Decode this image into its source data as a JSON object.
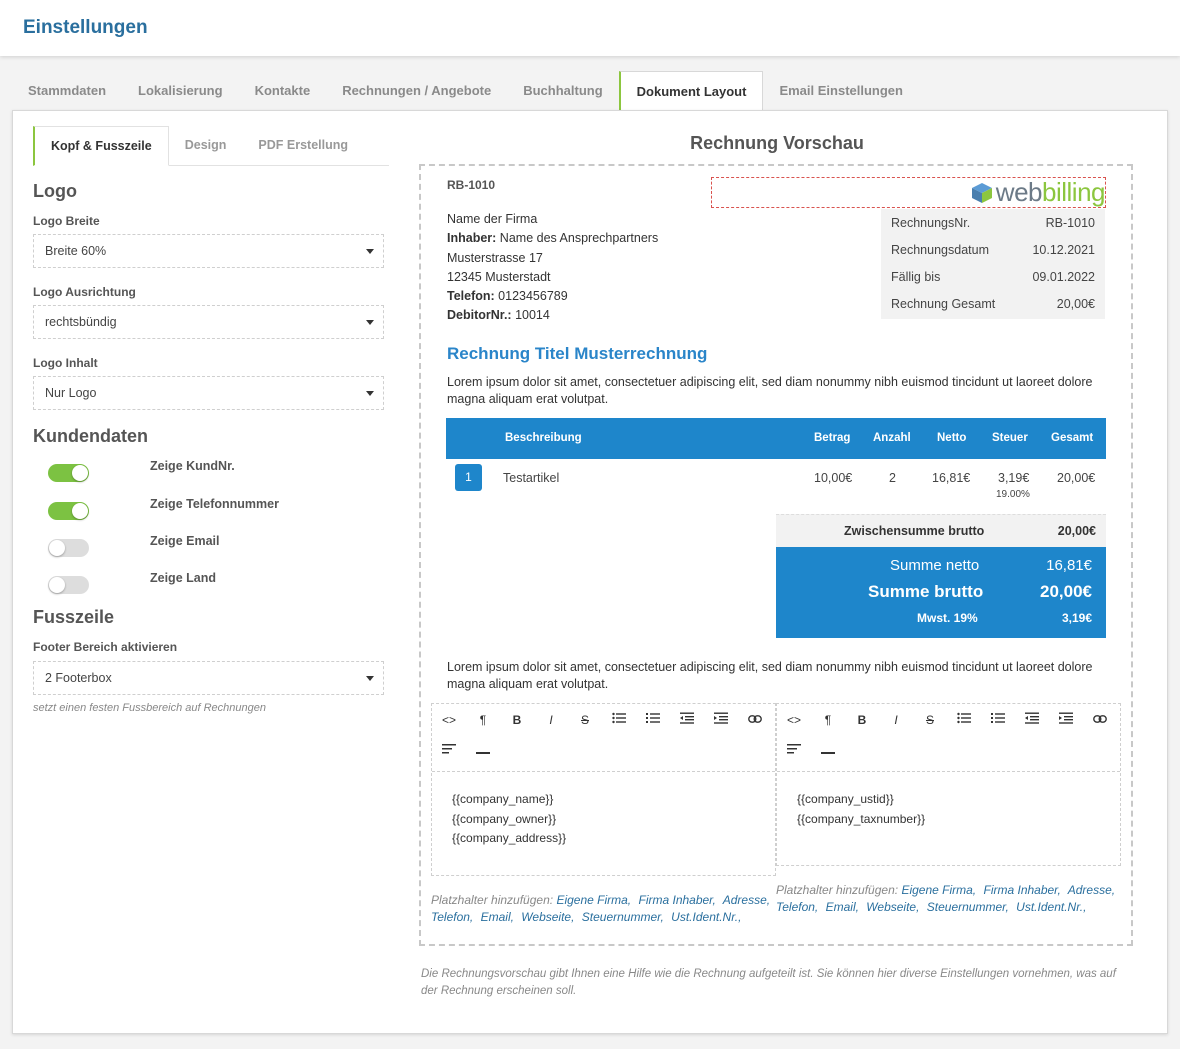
{
  "header": {
    "title": "Einstellungen"
  },
  "main_tabs": [
    {
      "label": "Stammdaten"
    },
    {
      "label": "Lokalisierung"
    },
    {
      "label": "Kontakte"
    },
    {
      "label": "Rechnungen / Angebote"
    },
    {
      "label": "Buchhaltung"
    },
    {
      "label": "Dokument Layout"
    },
    {
      "label": "Email Einstellungen"
    }
  ],
  "sub_tabs": [
    {
      "label": "Kopf & Fusszeile"
    },
    {
      "label": "Design"
    },
    {
      "label": "PDF Erstellung"
    }
  ],
  "logo": {
    "section_title": "Logo",
    "width_label": "Logo Breite",
    "width_value": "Breite 60%",
    "align_label": "Logo Ausrichtung",
    "align_value": "rechtsbündig",
    "content_label": "Logo Inhalt",
    "content_value": "Nur Logo"
  },
  "kundendaten": {
    "section_title": "Kundendaten",
    "toggles": [
      {
        "label": "Zeige KundNr.",
        "on": true
      },
      {
        "label": "Zeige Telefonnummer",
        "on": true
      },
      {
        "label": "Zeige Email",
        "on": false
      },
      {
        "label": "Zeige Land",
        "on": false
      }
    ]
  },
  "fusszeile": {
    "section_title": "Fusszeile",
    "footer_label": "Footer Bereich aktivieren",
    "footer_value": "2 Footerbox",
    "hint": "setzt einen festen Fussbereich auf Rechnungen"
  },
  "preview": {
    "title": "Rechnung Vorschau",
    "invoice_no": "RB-1010",
    "logo_text_a": "web",
    "logo_text_b": "billing",
    "address": {
      "company": "Name der Firma",
      "owner_label": "Inhaber:",
      "owner": "Name des Ansprechpartners",
      "street": "Musterstrasse 17",
      "city": "12345 Musterstadt",
      "phone_label": "Telefon:",
      "phone": "0123456789",
      "debtor_label": "DebitorNr.:",
      "debtor": "10014"
    },
    "info": [
      {
        "label": "RechnungsNr.",
        "value": "RB-1010"
      },
      {
        "label": "Rechnungsdatum",
        "value": "10.12.2021"
      },
      {
        "label": "Fällig bis",
        "value": "09.01.2022"
      },
      {
        "label": "Rechnung Gesamt",
        "value": "20,00€"
      }
    ],
    "invoice_title": "Rechnung Titel Musterrechnung",
    "lorem_top": "Lorem ipsum dolor sit amet, consectetuer adipiscing elit, sed diam nonummy nibh euismod tincidunt ut laoreet dolore magna aliquam erat volutpat.",
    "table_headers": {
      "desc": "Beschreibung",
      "amount": "Betrag",
      "qty": "Anzahl",
      "net": "Netto",
      "tax": "Steuer",
      "total": "Gesamt"
    },
    "row": {
      "pos": "1",
      "desc": "Testartikel",
      "amount": "10,00€",
      "qty": "2",
      "net": "16,81€",
      "tax": "3,19€",
      "tax_rate": "19.00%",
      "total": "20,00€"
    },
    "subtotal_label": "Zwischensumme brutto",
    "subtotal_value": "20,00€",
    "sum_net_label": "Summe netto",
    "sum_net_value": "16,81€",
    "sum_gross_label": "Summe brutto",
    "sum_gross_value": "20,00€",
    "vat_label": "Mwst. 19%",
    "vat_value": "3,19€",
    "lorem_bottom": "Lorem ipsum dolor sit amet, consectetuer adipiscing elit, sed diam nonummy nibh euismod tincidunt ut laoreet dolore magna aliquam erat volutpat.",
    "footer_left": [
      "{{company_name}}",
      "{{company_owner}}",
      "{{company_address}}"
    ],
    "footer_right": [
      "{{company_ustid}}",
      "{{company_taxnumber}}"
    ],
    "placeholder_prefix": "Platzhalter hinzufügen:",
    "placeholder_links": [
      "Eigene Firma,",
      "Firma Inhaber,",
      "Adresse,",
      "Telefon,",
      "Email,",
      "Webseite,",
      "Steuernummer,",
      "Ust.Ident.Nr.,"
    ],
    "toolbar_glyphs": {
      "code": "<>",
      "paragraph": "¶",
      "bold": "B",
      "italic": "I",
      "strike": "S"
    }
  },
  "footnote": "Die Rechnungsvorschau gibt Ihnen eine Hilfe wie die Rechnung aufgeteilt ist. Sie können hier diverse Einstellungen vornehmen, was auf der Rechnung erscheinen soll."
}
